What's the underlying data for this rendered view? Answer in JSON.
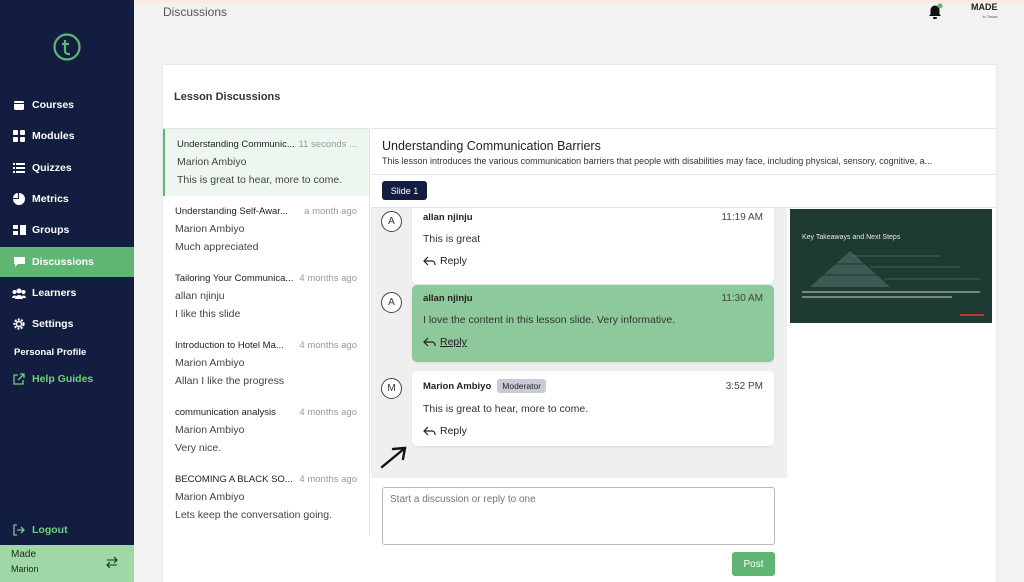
{
  "app": {
    "page_title": "Discussions",
    "brand_name": "MADE",
    "brand_sub": "in Tosaa"
  },
  "sidebar": {
    "items": [
      {
        "label": "Courses",
        "icon": "book-icon"
      },
      {
        "label": "Modules",
        "icon": "grid-icon"
      },
      {
        "label": "Quizzes",
        "icon": "list-icon"
      },
      {
        "label": "Metrics",
        "icon": "pie-chart-icon"
      },
      {
        "label": "Groups",
        "icon": "groups-icon"
      },
      {
        "label": "Discussions",
        "icon": "chat-icon"
      },
      {
        "label": "Learners",
        "icon": "people-icon"
      },
      {
        "label": "Settings",
        "icon": "gear-icon"
      }
    ],
    "personal_profile": "Personal Profile",
    "help_guides": "Help Guides",
    "logout": "Logout",
    "profile_org": "Made",
    "profile_user": "Marion"
  },
  "card": {
    "title": "Lesson Discussions"
  },
  "conversations": [
    {
      "title": "Understanding Communic...",
      "time": "11 seconds ...",
      "author": "Marion Ambiyo",
      "message": "This is great to hear, more to come."
    },
    {
      "title": "Understanding Self-Awar...",
      "time": "a month ago",
      "author": "Marion Ambiyo",
      "message": "Much appreciated"
    },
    {
      "title": "Tailoring Your Communica...",
      "time": "4 months ago",
      "author": "allan njinju",
      "message": "I like this slide"
    },
    {
      "title": "Introduction to Hotel Ma...",
      "time": "4 months ago",
      "author": "Marion Ambiyo",
      "message": "Allan I like the progress"
    },
    {
      "title": "communication analysis",
      "time": "4 months ago",
      "author": "Marion Ambiyo",
      "message": "Very nice."
    },
    {
      "title": "BECOMING A BLACK SO...",
      "time": "4 months ago",
      "author": "Marion Ambiyo",
      "message": "Lets keep the conversation going."
    }
  ],
  "detail": {
    "title": "Understanding Communication Barriers",
    "description": "This lesson introduces the various communication barriers that people with disabilities may face, including physical, sensory, cognitive, a...",
    "slide_tab": "Slide 1",
    "slide_preview_title": "Key Takeaways and Next Steps"
  },
  "messages": [
    {
      "avatar": "A",
      "author": "allan njinju",
      "time": "11:19 AM",
      "text": "This is great",
      "reply": "Reply",
      "highlight": false
    },
    {
      "avatar": "A",
      "author": "allan njinju",
      "time": "11:30 AM",
      "text": "I love the content in this lesson slide. Very informative.",
      "reply": "Reply",
      "highlight": true
    },
    {
      "avatar": "M",
      "author": "Marion Ambiyo",
      "badge": "Moderator",
      "time": "3:52 PM",
      "text": "This is great to hear, more to come.",
      "reply": "Reply",
      "highlight": false
    }
  ],
  "composer": {
    "placeholder": "Start a discussion or reply to one",
    "post_label": "Post"
  },
  "colors": {
    "sidebar": "#121d3f",
    "accent": "#5fb673",
    "highlight_bubble": "#8dc99a"
  }
}
